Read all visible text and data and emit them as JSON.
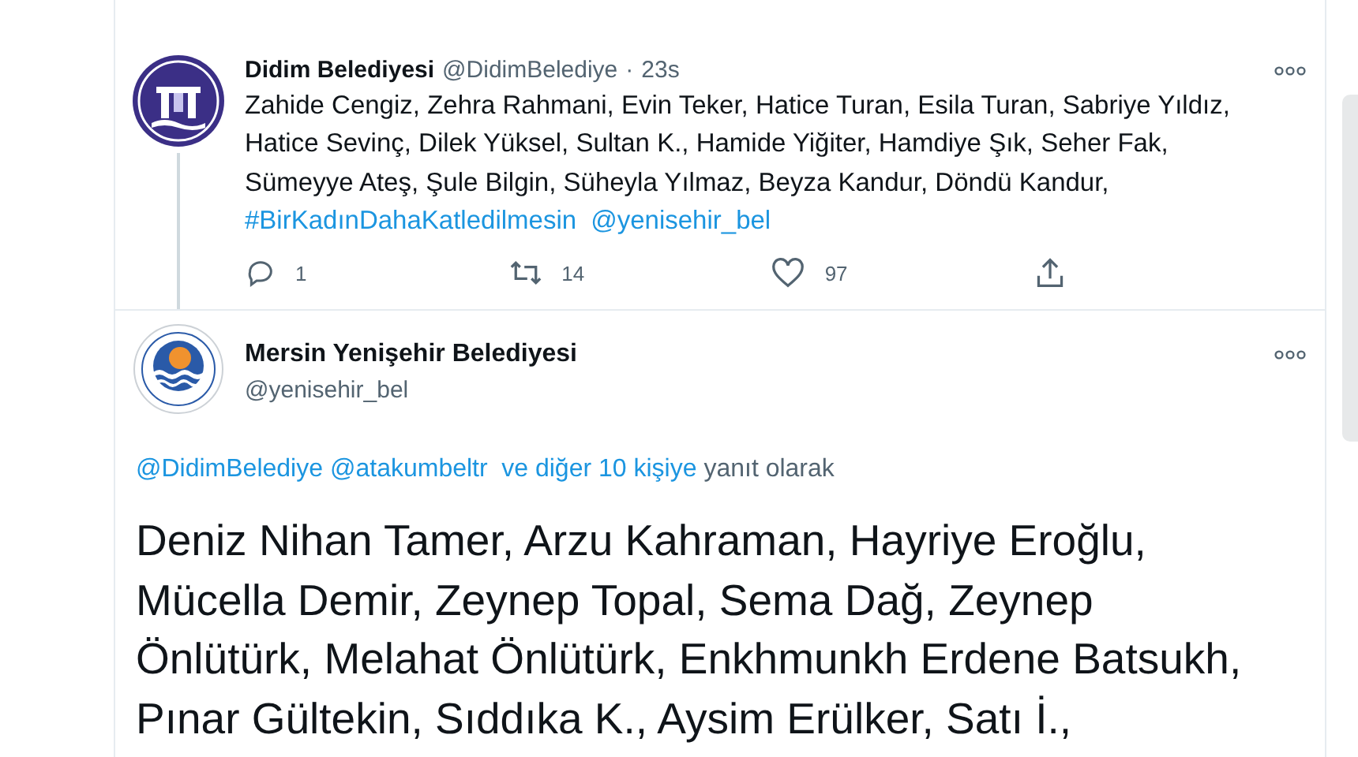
{
  "tweets": [
    {
      "name": "Didim Belediyesi",
      "handle": "@DidimBelediye",
      "separator": "·",
      "time": "23s",
      "kind": "inline",
      "avatar": {
        "kind": "columns"
      },
      "thread_line": true,
      "text": [
        {
          "kind": "plain",
          "text": "Zahide Cengiz, Zehra Rahmani, Evin Teker, Hatice Turan, Esila Turan, Sabriye Yıldız, Hatice Sevinç, Dilek Yüksel, Sultan K., Hamide Yiğiter, Hamdiye Şık, Seher Fak, Sümeyye Ateş, Şule Bilgin, Süheyla Yılmaz, Beyza Kandur, Döndü Kandur, "
        },
        {
          "kind": "link",
          "text": "#BirKadınDahaKatledilmesin"
        },
        {
          "kind": "link",
          "text": "@yenisehir_bel"
        }
      ],
      "actions": {
        "replies": "1",
        "retweets": "14",
        "likes": "97"
      }
    },
    {
      "name": "Mersin Yenişehir Belediyesi",
      "handle": "@yenisehir_bel",
      "kind": "stacked",
      "avatar": {
        "kind": "sea"
      },
      "reply_to": [
        {
          "kind": "link",
          "text": "@DidimBelediye"
        },
        {
          "kind": "link",
          "text": "@atakumbeltr"
        },
        {
          "kind": "link",
          "text": "ve diğer 10 kişiye"
        },
        {
          "kind": "plain",
          "text": " yanıt olarak"
        }
      ],
      "text": [
        {
          "kind": "plain",
          "text": "Deniz Nihan Tamer, Arzu Kahraman, Hayriye Eroğlu, Mücella Demir, Zeynep Topal, Sema Dağ, Zeynep Önlütürk, Melahat Önlütürk, Enkhmunkh Erdene Batsukh, Pınar Gültekin, Sıddıka K., Aysim Erülker, Satı İ.,"
        }
      ]
    }
  ]
}
